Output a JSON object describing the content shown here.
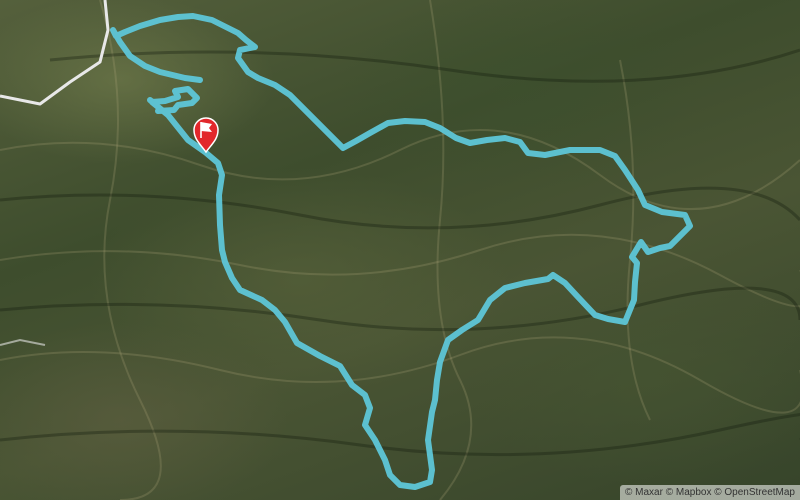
{
  "map": {
    "type": "satellite",
    "route_color": "#5ec6d8",
    "road_color": "#e8e8e8",
    "marker_color": "#e2272b",
    "marker_icon": "flag-icon",
    "attribution": {
      "parts": [
        "© Maxar",
        "© Mapbox",
        "© OpenStreetMap"
      ]
    }
  }
}
